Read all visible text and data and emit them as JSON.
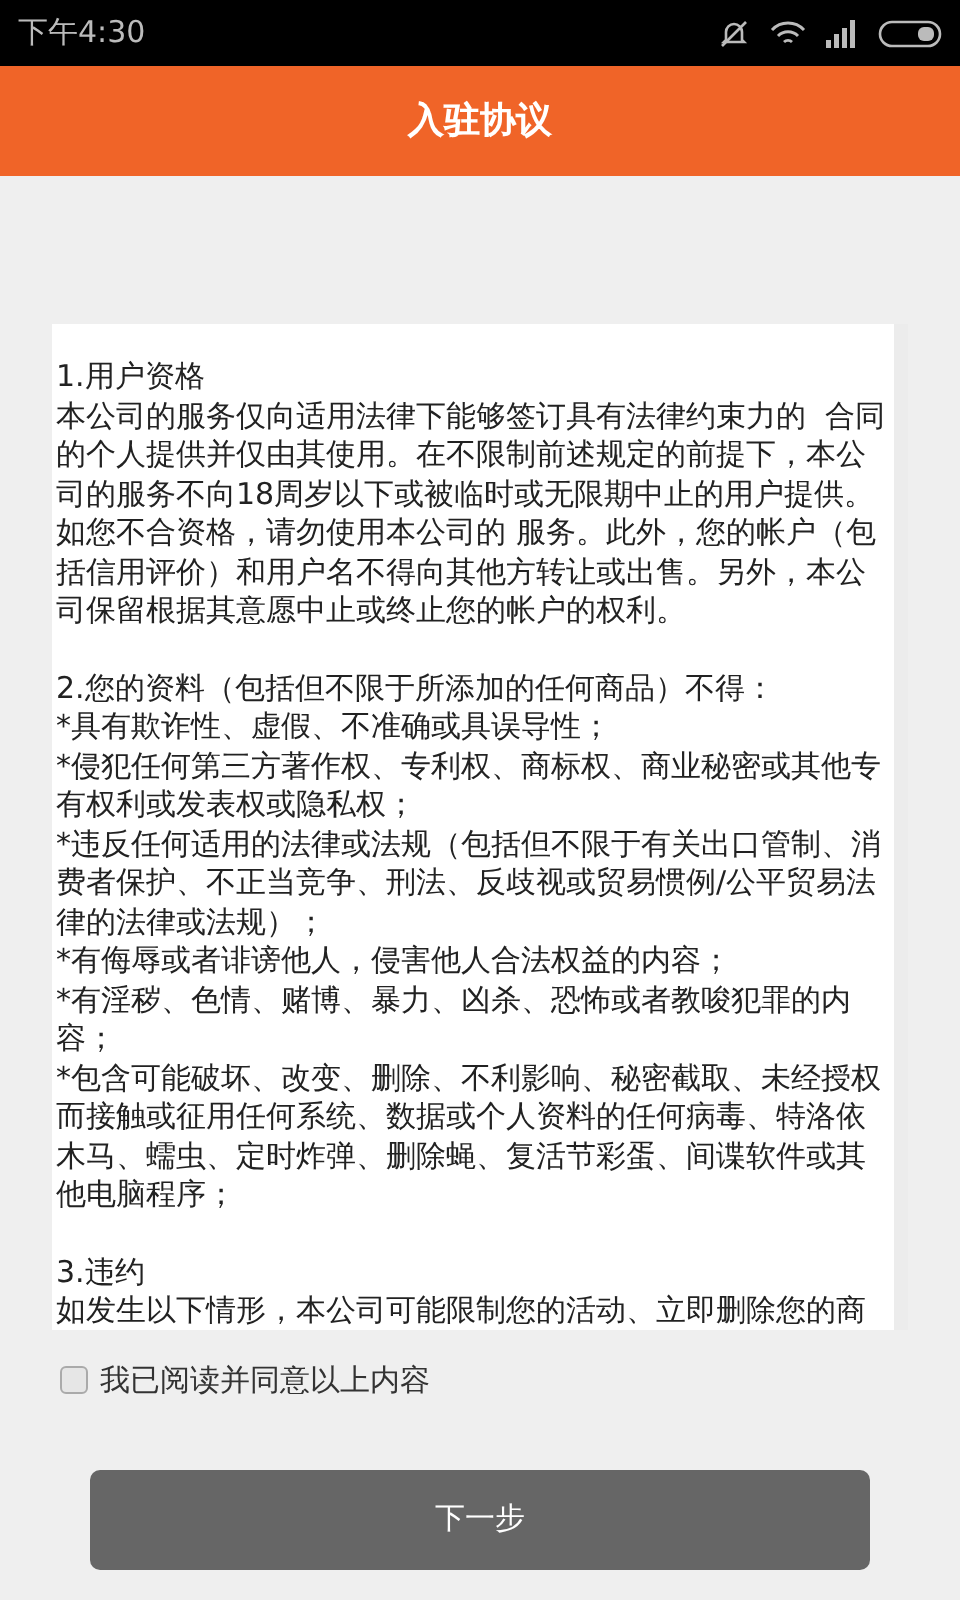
{
  "status_bar": {
    "time": "下午4:30"
  },
  "header": {
    "title": "入驻协议"
  },
  "agreement": {
    "sections": [
      {
        "lines": [
          "1.用户资格",
          "本公司的服务仅向适用法律下能够签订具有法律约束力的  合同",
          "的个人提供并仅由其使用。在不限制前述规定的前提下，本公",
          "司的服务不向18周岁以下或被临时或无限期中止的用户提供。",
          "如您不合资格，请勿使用本公司的 服务。此外，您的帐户（包",
          "括信用评价）和用户名不得向其他方转让或出售。另外，本公",
          "司保留根据其意愿中止或终止您的帐户的权利。"
        ]
      },
      {
        "lines": [
          "2.您的资料（包括但不限于所添加的任何商品）不得：",
          "*具有欺诈性、虚假、不准确或具误导性；",
          "*侵犯任何第三方著作权、专利权、商标权、商业秘密或其他专",
          "有权利或发表权或隐私权；",
          "*违反任何适用的法律或法规（包括但不限于有关出口管制、消",
          "费者保护、不正当竞争、刑法、反歧视或贸易惯例/公平贸易法",
          "律的法律或法规）；",
          "*有侮辱或者诽谤他人，侵害他人合法权益的内容；",
          "*有淫秽、色情、赌博、暴力、凶杀、恐怖或者教唆犯罪的内",
          "容；",
          "*包含可能破坏、改变、删除、不利影响、秘密截取、未经授权",
          "而接触或征用任何系统、数据或个人资料的任何病毒、特洛依",
          "木马、蠕虫、定时炸弹、删除蝇、复活节彩蛋、间谍软件或其",
          "他电脑程序；"
        ]
      },
      {
        "lines": [
          "3.违约",
          "如发生以下情形，本公司可能限制您的活动、立即删除您的商"
        ]
      }
    ]
  },
  "consent": {
    "label": "我已阅读并同意以上内容",
    "checked": false
  },
  "next_button": {
    "label": "下一步"
  }
}
